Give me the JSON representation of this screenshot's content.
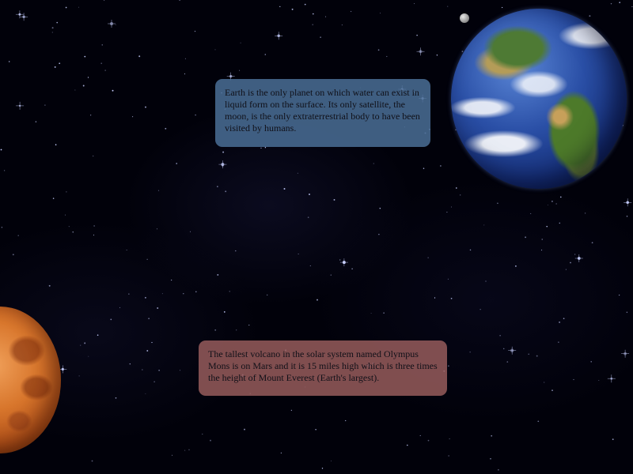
{
  "earth_fact": {
    "text": "Earth is the only planet on which water can exist in liquid form on the surface. Its only satellite, the moon, is the only extraterrestrial body to have been visited by humans."
  },
  "mars_fact": {
    "text": "The tallest volcano in the solar system named Olympus Mons is on Mars and it is 15 miles high which is three times the height of Mount Everest (Earth's largest)."
  },
  "colors": {
    "background": "#01010a",
    "earth_box": "#4a6e96",
    "mars_box": "#965c5c",
    "star": "#c8d0ff"
  }
}
